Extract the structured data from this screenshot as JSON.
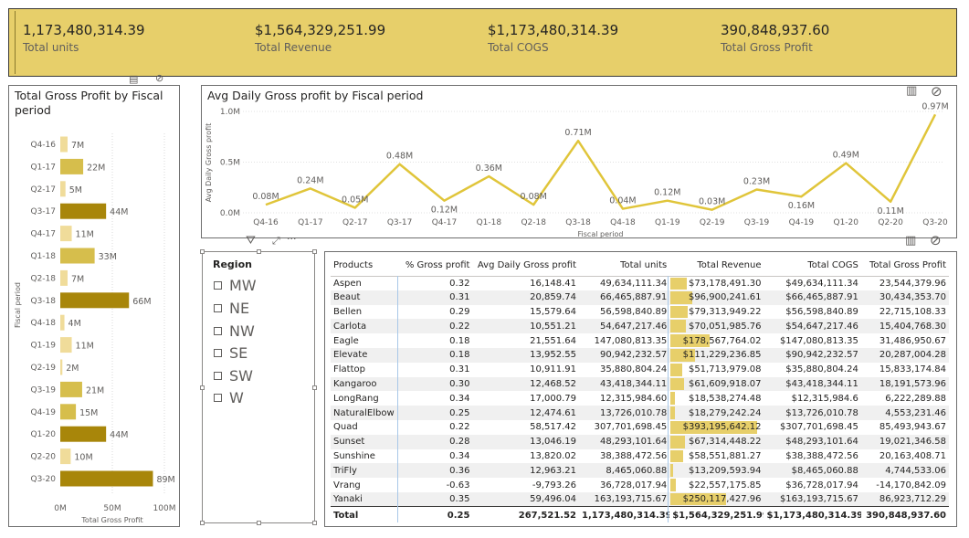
{
  "kpis": [
    {
      "value": "1,173,480,314.39",
      "label": "Total units"
    },
    {
      "value": "$1,564,329,251.99",
      "label": "Total Revenue"
    },
    {
      "value": "$1,173,480,314.39",
      "label": "Total COGS"
    },
    {
      "value": "390,848,937.60",
      "label": "Total Gross Profit"
    }
  ],
  "colors": {
    "accent": "#e7cf6a",
    "bar_dark": "#a8860a",
    "bar_mid": "#d6be4c",
    "bar_light": "#f0dc9a",
    "line": "#e0c53a",
    "row_alt": "#f0f0f0"
  },
  "bar_chart": {
    "title": "Total Gross Profit by Fiscal period",
    "chart_data": {
      "type": "bar",
      "orientation": "horizontal",
      "categories": [
        "Q4-16",
        "Q1-17",
        "Q2-17",
        "Q3-17",
        "Q4-17",
        "Q1-18",
        "Q2-18",
        "Q3-18",
        "Q4-18",
        "Q1-19",
        "Q2-19",
        "Q3-19",
        "Q4-19",
        "Q1-20",
        "Q2-20",
        "Q3-20"
      ],
      "values": [
        7,
        22,
        5,
        44,
        11,
        33,
        7,
        66,
        4,
        11,
        2,
        21,
        15,
        44,
        10,
        89
      ],
      "data_labels": [
        "7M",
        "22M",
        "5M",
        "44M",
        "11M",
        "33M",
        "7M",
        "66M",
        "4M",
        "11M",
        "2M",
        "21M",
        "15M",
        "44M",
        "10M",
        "89M"
      ],
      "xlabel": "Total Gross Profit",
      "ylabel": "Fiscal period",
      "xlim": [
        0,
        100
      ],
      "xticks": [
        "0M",
        "50M",
        "100M"
      ]
    }
  },
  "line_chart": {
    "title": "Avg Daily Gross profit by Fiscal period",
    "chart_data": {
      "type": "line",
      "categories": [
        "Q4-16",
        "Q1-17",
        "Q2-17",
        "Q3-17",
        "Q4-17",
        "Q1-18",
        "Q2-18",
        "Q3-18",
        "Q4-18",
        "Q1-19",
        "Q2-19",
        "Q3-19",
        "Q4-19",
        "Q1-20",
        "Q2-20",
        "Q3-20"
      ],
      "values": [
        0.08,
        0.24,
        0.05,
        0.48,
        0.12,
        0.36,
        0.08,
        0.71,
        0.04,
        0.12,
        0.03,
        0.23,
        0.16,
        0.49,
        0.11,
        0.97
      ],
      "data_labels": [
        "0.08M",
        "0.24M",
        "0.05M",
        "0.48M",
        "0.12M",
        "0.36M",
        "0.08M",
        "0.71M",
        "0.04M",
        "0.12M",
        "0.03M",
        "0.23M",
        "0.16M",
        "0.49M",
        "0.11M",
        "0.97M"
      ],
      "xlabel": "Fiscal period",
      "ylabel": "Avg Daily Gross profit",
      "ylim": [
        0,
        1.0
      ],
      "yticks": [
        "0.0M",
        "0.5M",
        "1.0M"
      ]
    }
  },
  "slicer": {
    "title": "Region",
    "items": [
      "MW",
      "NE",
      "NW",
      "SE",
      "SW",
      "W"
    ]
  },
  "table": {
    "columns": [
      "Products",
      "% Gross profit",
      "Avg Daily Gross profit",
      "Total units",
      "Total Revenue",
      "Total COGS",
      "Total Gross Profit"
    ],
    "rows": [
      {
        "product": "Aspen",
        "pct": "0.32",
        "avg": "16,148.41",
        "units": "49,634,111.34",
        "revenue": "$73,178,491.30",
        "rev_value": 73.18,
        "cogs": "$49,634,111.34",
        "gp": "23,544,379.96"
      },
      {
        "product": "Beaut",
        "pct": "0.31",
        "avg": "20,859.74",
        "units": "66,465,887.91",
        "revenue": "$96,900,241.61",
        "rev_value": 96.9,
        "cogs": "$66,465,887.91",
        "gp": "30,434,353.70"
      },
      {
        "product": "Bellen",
        "pct": "0.29",
        "avg": "15,579.64",
        "units": "56,598,840.89",
        "revenue": "$79,313,949.22",
        "rev_value": 79.31,
        "cogs": "$56,598,840.89",
        "gp": "22,715,108.33"
      },
      {
        "product": "Carlota",
        "pct": "0.22",
        "avg": "10,551.21",
        "units": "54,647,217.46",
        "revenue": "$70,051,985.76",
        "rev_value": 70.05,
        "cogs": "$54,647,217.46",
        "gp": "15,404,768.30"
      },
      {
        "product": "Eagle",
        "pct": "0.18",
        "avg": "21,551.64",
        "units": "147,080,813.35",
        "revenue": "$178,567,764.02",
        "rev_value": 178.57,
        "cogs": "$147,080,813.35",
        "gp": "31,486,950.67"
      },
      {
        "product": "Elevate",
        "pct": "0.18",
        "avg": "13,952.55",
        "units": "90,942,232.57",
        "revenue": "$111,229,236.85",
        "rev_value": 111.23,
        "cogs": "$90,942,232.57",
        "gp": "20,287,004.28"
      },
      {
        "product": "Flattop",
        "pct": "0.31",
        "avg": "10,911.91",
        "units": "35,880,804.24",
        "revenue": "$51,713,979.08",
        "rev_value": 51.71,
        "cogs": "$35,880,804.24",
        "gp": "15,833,174.84"
      },
      {
        "product": "Kangaroo",
        "pct": "0.30",
        "avg": "12,468.52",
        "units": "43,418,344.11",
        "revenue": "$61,609,918.07",
        "rev_value": 61.61,
        "cogs": "$43,418,344.11",
        "gp": "18,191,573.96"
      },
      {
        "product": "LongRang",
        "pct": "0.34",
        "avg": "17,000.79",
        "units": "12,315,984.60",
        "revenue": "$18,538,274.48",
        "rev_value": 18.54,
        "cogs": "$12,315,984.6",
        "gp": "6,222,289.88"
      },
      {
        "product": "NaturalElbow",
        "pct": "0.25",
        "avg": "12,474.61",
        "units": "13,726,010.78",
        "revenue": "$18,279,242.24",
        "rev_value": 18.28,
        "cogs": "$13,726,010.78",
        "gp": "4,553,231.46"
      },
      {
        "product": "Quad",
        "pct": "0.22",
        "avg": "58,517.42",
        "units": "307,701,698.45",
        "revenue": "$393,195,642.12",
        "rev_value": 393.2,
        "cogs": "$307,701,698.45",
        "gp": "85,493,943.67"
      },
      {
        "product": "Sunset",
        "pct": "0.28",
        "avg": "13,046.19",
        "units": "48,293,101.64",
        "revenue": "$67,314,448.22",
        "rev_value": 67.31,
        "cogs": "$48,293,101.64",
        "gp": "19,021,346.58"
      },
      {
        "product": "Sunshine",
        "pct": "0.34",
        "avg": "13,820.02",
        "units": "38,388,472.56",
        "revenue": "$58,551,881.27",
        "rev_value": 58.55,
        "cogs": "$38,388,472.56",
        "gp": "20,163,408.71"
      },
      {
        "product": "TriFly",
        "pct": "0.36",
        "avg": "12,963.21",
        "units": "8,465,060.88",
        "revenue": "$13,209,593.94",
        "rev_value": 13.21,
        "cogs": "$8,465,060.88",
        "gp": "4,744,533.06"
      },
      {
        "product": "Vrang",
        "pct": "-0.63",
        "avg": "-9,793.26",
        "units": "36,728,017.94",
        "revenue": "$22,557,175.85",
        "rev_value": 22.56,
        "cogs": "$36,728,017.94",
        "gp": "-14,170,842.09"
      },
      {
        "product": "Yanaki",
        "pct": "0.35",
        "avg": "59,496.04",
        "units": "163,193,715.67",
        "revenue": "$250,117,427.96",
        "rev_value": 250.12,
        "cogs": "$163,193,715.67",
        "gp": "86,923,712.29"
      }
    ],
    "total": {
      "product": "Total",
      "pct": "0.25",
      "avg": "267,521.52",
      "units": "1,173,480,314.39",
      "revenue": "$1,564,329,251.99",
      "cogs": "$1,173,480,314.39",
      "gp": "390,848,937.60"
    }
  }
}
